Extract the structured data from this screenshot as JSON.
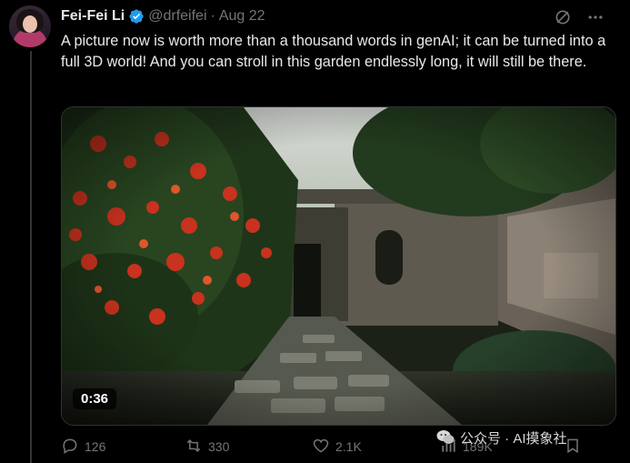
{
  "author": {
    "name": "Fei-Fei Li",
    "handle": "@drfeifei",
    "separator": "·",
    "date": "Aug 22",
    "verified": true
  },
  "tweet": {
    "text": "A picture now is worth more than a thousand words in genAI; it can be turned into a full 3D world! And you can stroll in this garden endlessly long, it will still be there."
  },
  "media": {
    "duration": "0:36"
  },
  "actions": {
    "replies": "126",
    "reposts": "330",
    "likes": "2.1K",
    "views": "189K"
  },
  "watermark": {
    "text": "公众号 · AI摸象社"
  },
  "colors": {
    "background": "#000000",
    "text": "#e7e9ea",
    "muted": "#71767b",
    "verified": "#1d9bf0"
  },
  "icons": {
    "top": [
      "grok-icon",
      "more-icon"
    ],
    "actions": [
      "reply-icon",
      "repost-icon",
      "like-icon",
      "views-icon",
      "bookmark-icon"
    ]
  }
}
